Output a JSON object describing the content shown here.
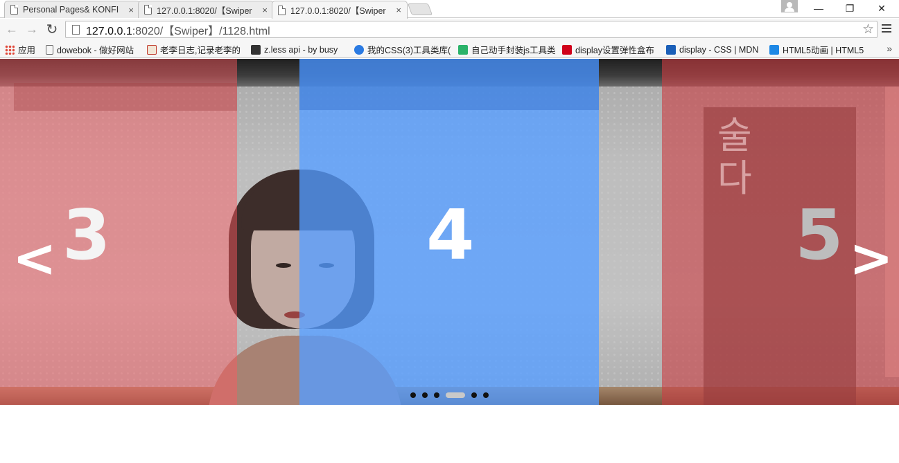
{
  "browser": {
    "tabs": [
      {
        "title": "Personal Pages& KONFI",
        "close": "×",
        "active": false
      },
      {
        "title": "127.0.0.1:8020/【Swiper",
        "close": "×",
        "active": false
      },
      {
        "title": "127.0.0.1:8020/【Swiper",
        "close": "×",
        "active": true
      }
    ],
    "window_controls": {
      "minimize": "—",
      "restore": "❐",
      "close": "✕"
    },
    "nav": {
      "back": "←",
      "forward": "→",
      "reload": "↻"
    },
    "address": {
      "host": "127.0.0.1",
      "rest": ":8020/【Swiper】/1128.html"
    },
    "star": "☆",
    "bookmarks": [
      {
        "label": "应用",
        "icon": "apps-grid-icon",
        "color": "#e0493b"
      },
      {
        "label": "dowebok - 做好网站",
        "icon": "page-icon",
        "color": "#ffffff"
      },
      {
        "label": "老李日志,记录老李的",
        "icon": "book-icon",
        "color": "#c0392b"
      },
      {
        "label": "z.less api - by busy",
        "icon": "z-icon",
        "color": "#333333"
      },
      {
        "label": "我的CSS(3)工具类库(",
        "icon": "globe-icon",
        "color": "#2a7ae2"
      },
      {
        "label": "自己动手封装js工具类",
        "icon": "z-green-icon",
        "color": "#2bb36a"
      },
      {
        "label": "display设置弹性盒布",
        "icon": "c-red-icon",
        "color": "#d0021b"
      },
      {
        "label": "display - CSS | MDN",
        "icon": "mdn-icon",
        "color": "#1b5fb8"
      },
      {
        "label": "HTML5动画 | HTML5",
        "icon": "wifi-icon",
        "color": "#1e88e5"
      }
    ],
    "bookmarks_more": "»"
  },
  "swiper": {
    "slides": [
      {
        "number": "3",
        "state": "prev"
      },
      {
        "number": "4",
        "state": "active"
      },
      {
        "number": "5",
        "state": "next"
      }
    ],
    "prev_arrow": "<",
    "next_arrow": ">",
    "pagination": {
      "count": 6,
      "active_index": 3
    },
    "poster_text": "술약\n다랄",
    "colors": {
      "prev_slide": "#d05458",
      "active_slide": "#5096f5",
      "next_slide": "#b63e42"
    }
  }
}
